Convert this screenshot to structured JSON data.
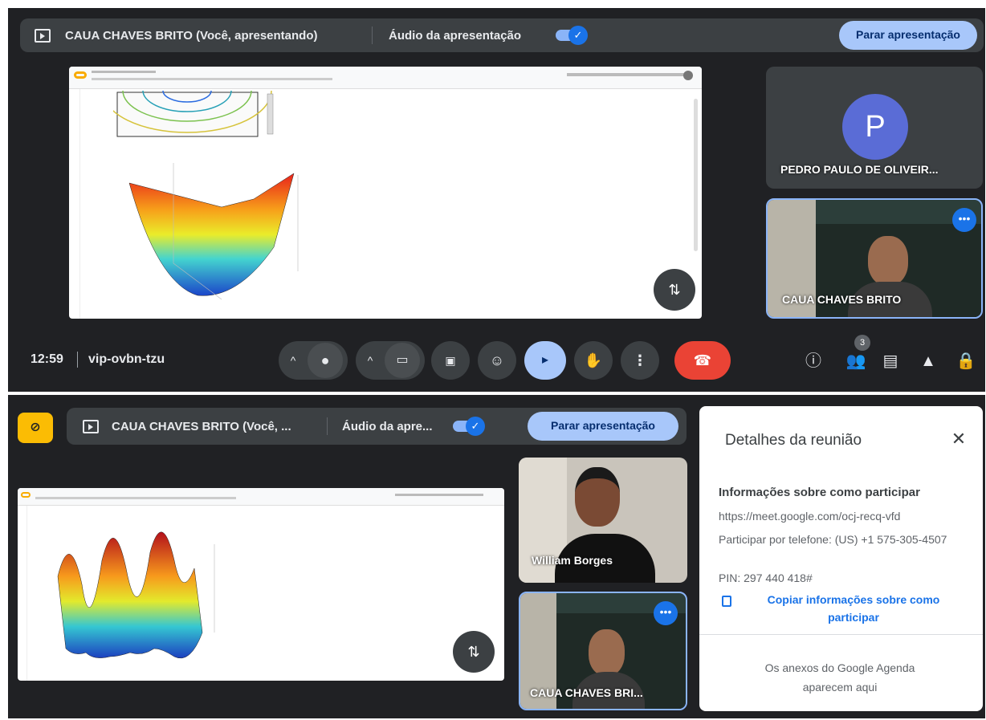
{
  "top": {
    "presenter_label": "CAUA CHAVES BRITO (Você, apresentando)",
    "audio_label": "Áudio da apresentação",
    "stop_label": "Parar apresentação",
    "participants": [
      {
        "initial": "P",
        "name": "PEDRO PAULO DE OLIVEIR..."
      },
      {
        "name": "CAUA CHAVES BRITO"
      }
    ],
    "time": "12:59",
    "meeting_code": "vip-ovbn-tzu",
    "people_count": "3"
  },
  "bottom": {
    "presenter_label": "CAUA CHAVES BRITO (Você, ...",
    "audio_label": "Áudio da apre...",
    "stop_label": "Parar apresentação",
    "participants": [
      {
        "name": "William Borges"
      },
      {
        "name": "CAUA CHAVES BRI..."
      }
    ]
  },
  "details": {
    "title": "Detalhes da reunião",
    "join_heading": "Informações sobre como participar",
    "link": "https://meet.google.com/ocj-recq-vfd",
    "phone": "Participar por telefone: (US) +1 575-305-4507",
    "pin": "PIN: 297 440 418#",
    "copy_label": "Copiar informações sobre como participar",
    "attachments": "Os anexos do Google Agenda aparecem aqui"
  },
  "colors": {
    "background": "#202124",
    "surface": "#3c4043",
    "accent": "#a8c7fa",
    "end_call": "#ea4335",
    "blue": "#1a73e8",
    "warning": "#fbbc04"
  }
}
